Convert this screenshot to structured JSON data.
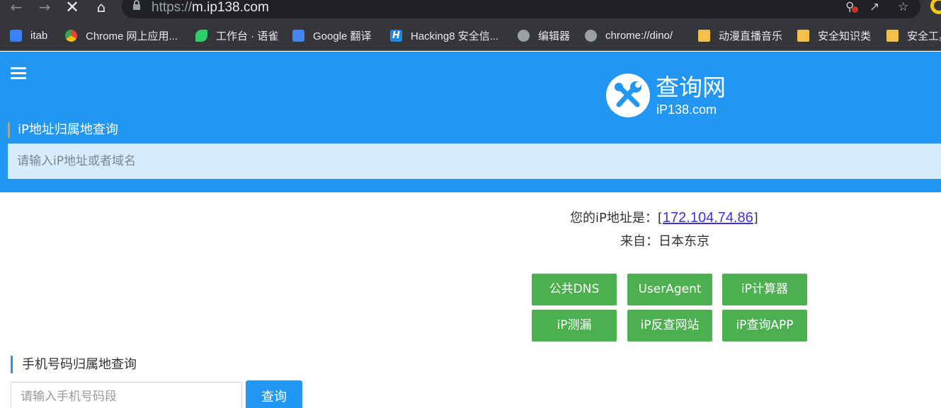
{
  "browser": {
    "url_scheme": "https://",
    "url_host": "m.ip138.com",
    "bookmarks": [
      {
        "label": "itab",
        "icon": "itab-icon"
      },
      {
        "label": "Chrome 网上应用...",
        "icon": "chrome-webstore-icon"
      },
      {
        "label": "工作台 · 语雀",
        "icon": "yuque-icon"
      },
      {
        "label": "Google 翻译",
        "icon": "google-translate-icon"
      },
      {
        "label": "Hacking8 安全信...",
        "icon": "hacking8-icon"
      },
      {
        "label": "编辑器",
        "icon": "globe-icon"
      },
      {
        "label": "chrome://dino/",
        "icon": "globe-icon"
      },
      {
        "label": "动漫直播音乐",
        "icon": "folder-icon"
      },
      {
        "label": "安全知识类",
        "icon": "folder-icon"
      },
      {
        "label": "安全工具",
        "icon": "folder-icon"
      }
    ]
  },
  "header": {
    "logo_title": "查询网",
    "logo_domain": "iP138.com",
    "ip_section_title": "iP地址归属地查询",
    "ip_input_placeholder": "请输入iP地址或者域名"
  },
  "ip_info": {
    "prefix": "您的iP地址是：[",
    "ip": "172.104.74.86",
    "suffix": "]",
    "location_label": "来自：",
    "location": "日本东京"
  },
  "tools": [
    "公共DNS",
    "UserAgent",
    "iP计算器",
    "iP测漏",
    "iP反查网站",
    "iP查询APP"
  ],
  "phone": {
    "title": "手机号码归属地查询",
    "placeholder": "请输入手机号码段",
    "button": "查询"
  },
  "colors": {
    "header_blue": "#2196f3",
    "input_light_blue": "#d6ebfc",
    "button_green": "#4caf50",
    "accent_orange": "#ff9800",
    "link_purple_blue": "#3d33d6",
    "chrome_dark": "#35363a"
  }
}
